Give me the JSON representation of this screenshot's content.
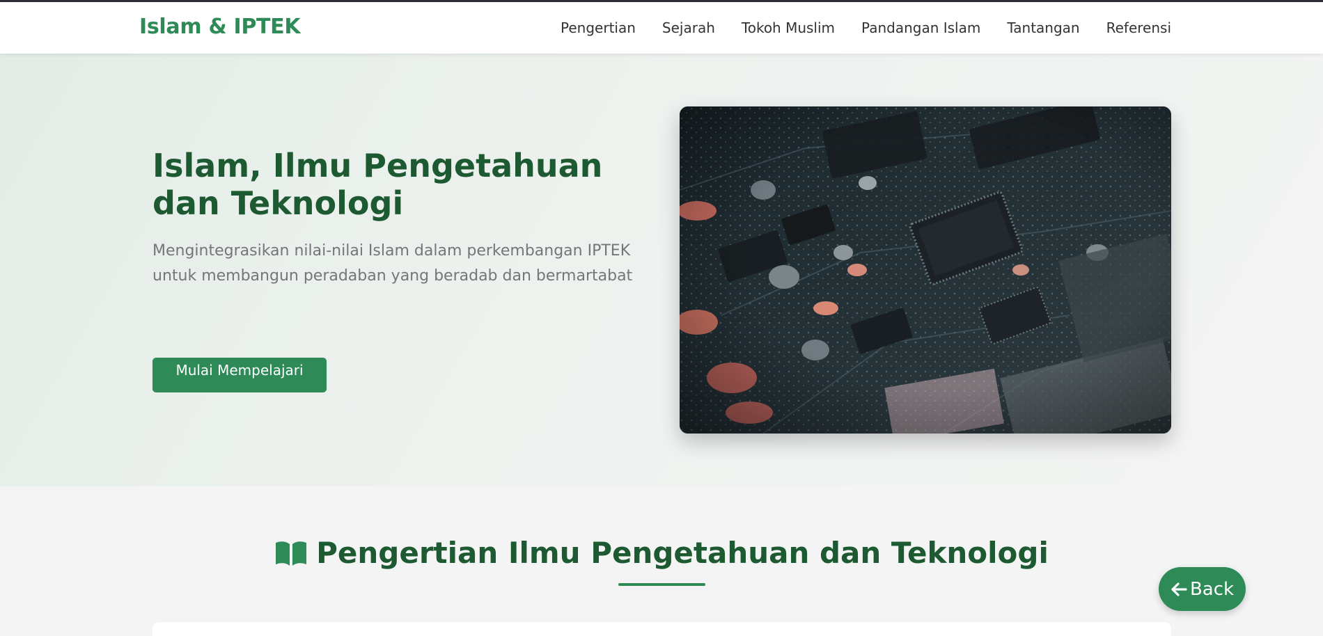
{
  "navbar": {
    "brand": "Islam & IPTEK",
    "links": [
      "Pengertian",
      "Sejarah",
      "Tokoh Muslim",
      "Pandangan Islam",
      "Tantangan",
      "Referensi"
    ]
  },
  "hero": {
    "title": "Islam, Ilmu Pengetahuan dan Teknologi",
    "subtitle": "Mengintegrasikan nilai-nilai Islam dalam perkembangan IPTEK untuk membangun peradaban yang beradab dan bermartabat",
    "cta_label": "Mulai Mempelajari",
    "image_icon": "circuit-board-photo"
  },
  "section": {
    "icon": "open-book-icon",
    "title": "Pengertian Ilmu Pengetahuan dan Teknologi"
  },
  "back_button": {
    "icon": "arrow-left-icon",
    "label": "Back"
  },
  "colors": {
    "accent": "#2e8b57",
    "heading": "#1d5a31",
    "muted_text": "#767676"
  }
}
